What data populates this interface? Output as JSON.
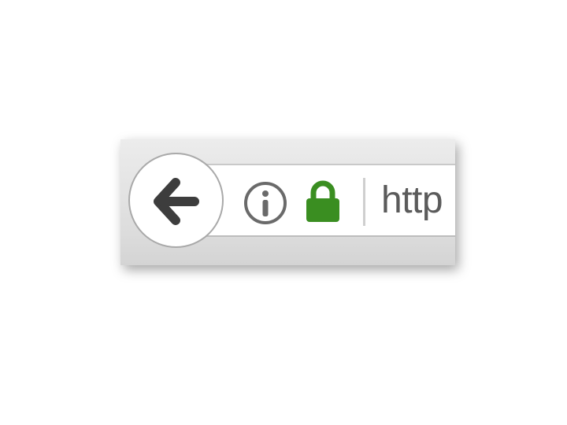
{
  "toolbar": {
    "back_button": {
      "icon": "arrow-left-icon",
      "label": ""
    },
    "site_info_button": {
      "icon": "info-circle-icon"
    },
    "security_indicator": {
      "icon": "lock-icon",
      "color": "#3a8e21"
    },
    "url": {
      "value": "http"
    }
  },
  "colors": {
    "arrow": "#3d3d3d",
    "info": "#6a6a6a",
    "lock": "#3a8e21",
    "url_text": "#5b5b5b"
  }
}
